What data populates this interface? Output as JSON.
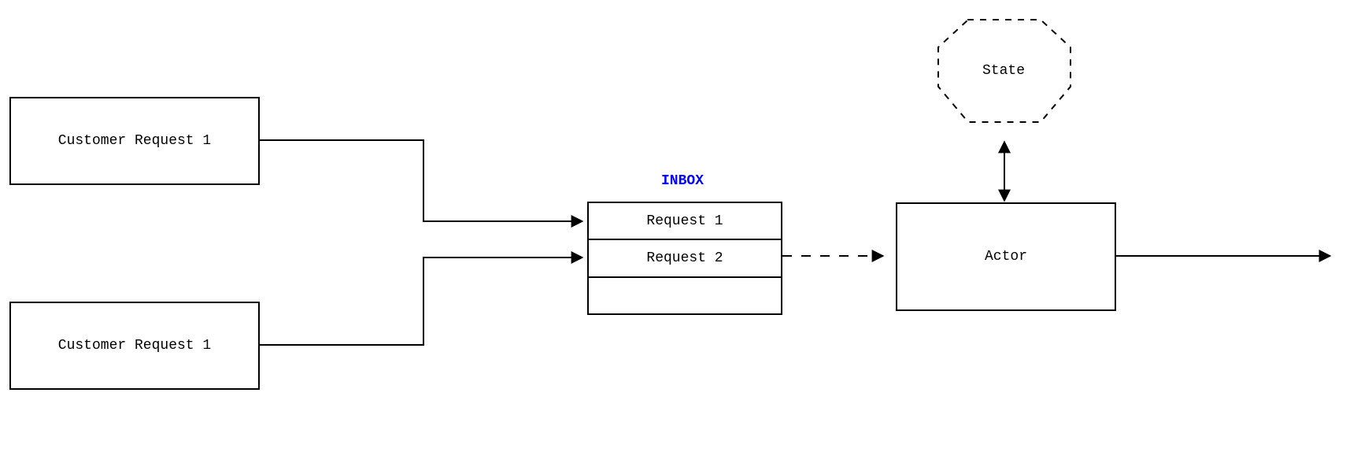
{
  "customer1": {
    "label": "Customer Request 1"
  },
  "customer2": {
    "label": "Customer Request 1"
  },
  "inbox": {
    "title": "INBOX",
    "rows": [
      "Request 1",
      "Request 2",
      ""
    ]
  },
  "actor": {
    "label": "Actor"
  },
  "state": {
    "label": "State"
  }
}
